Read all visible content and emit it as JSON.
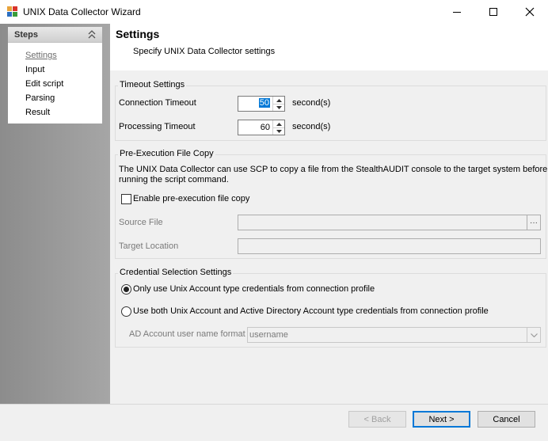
{
  "window": {
    "title": "UNIX Data Collector Wizard",
    "minimize_icon": "minimize-icon",
    "maximize_icon": "maximize-icon",
    "close_icon": "close-icon"
  },
  "steps": {
    "header": "Steps",
    "collapse_icon": "double-chevron-up-icon",
    "items": [
      {
        "label": "Settings",
        "current": true
      },
      {
        "label": "Input",
        "current": false
      },
      {
        "label": "Edit script",
        "current": false
      },
      {
        "label": "Parsing",
        "current": false
      },
      {
        "label": "Result",
        "current": false
      }
    ]
  },
  "page": {
    "title": "Settings",
    "subtitle": "Specify UNIX Data Collector settings"
  },
  "timeout": {
    "group_title": "Timeout Settings",
    "connection_label": "Connection Timeout",
    "connection_value": "50",
    "processing_label": "Processing Timeout",
    "processing_value": "60",
    "unit": "second(s)"
  },
  "preexec": {
    "group_title": "Pre-Execution File Copy",
    "description_line1": "The UNIX Data Collector can use SCP to copy a file from the StealthAUDIT console to the target system before",
    "description_line2": "running the script command.",
    "enable_label": "Enable pre-execution file copy",
    "enable_checked": false,
    "source_label": "Source File",
    "source_value": "",
    "browse_label": "···",
    "target_label": "Target Location",
    "target_value": ""
  },
  "credentials": {
    "group_title": "Credential Selection Settings",
    "option1_label": "Only use Unix Account type credentials from connection profile",
    "option1_checked": true,
    "option2_label": "Use both Unix Account and Active Directory Account type credentials from connection profile",
    "option2_checked": false,
    "ad_format_label": "AD Account user name format",
    "ad_format_value": "username"
  },
  "footer": {
    "back_label": "< Back",
    "next_label": "Next >",
    "cancel_label": "Cancel"
  },
  "colors": {
    "accent": "#0078d7",
    "panel_gray": "#9a9a9a",
    "background": "#f0f0f0"
  }
}
